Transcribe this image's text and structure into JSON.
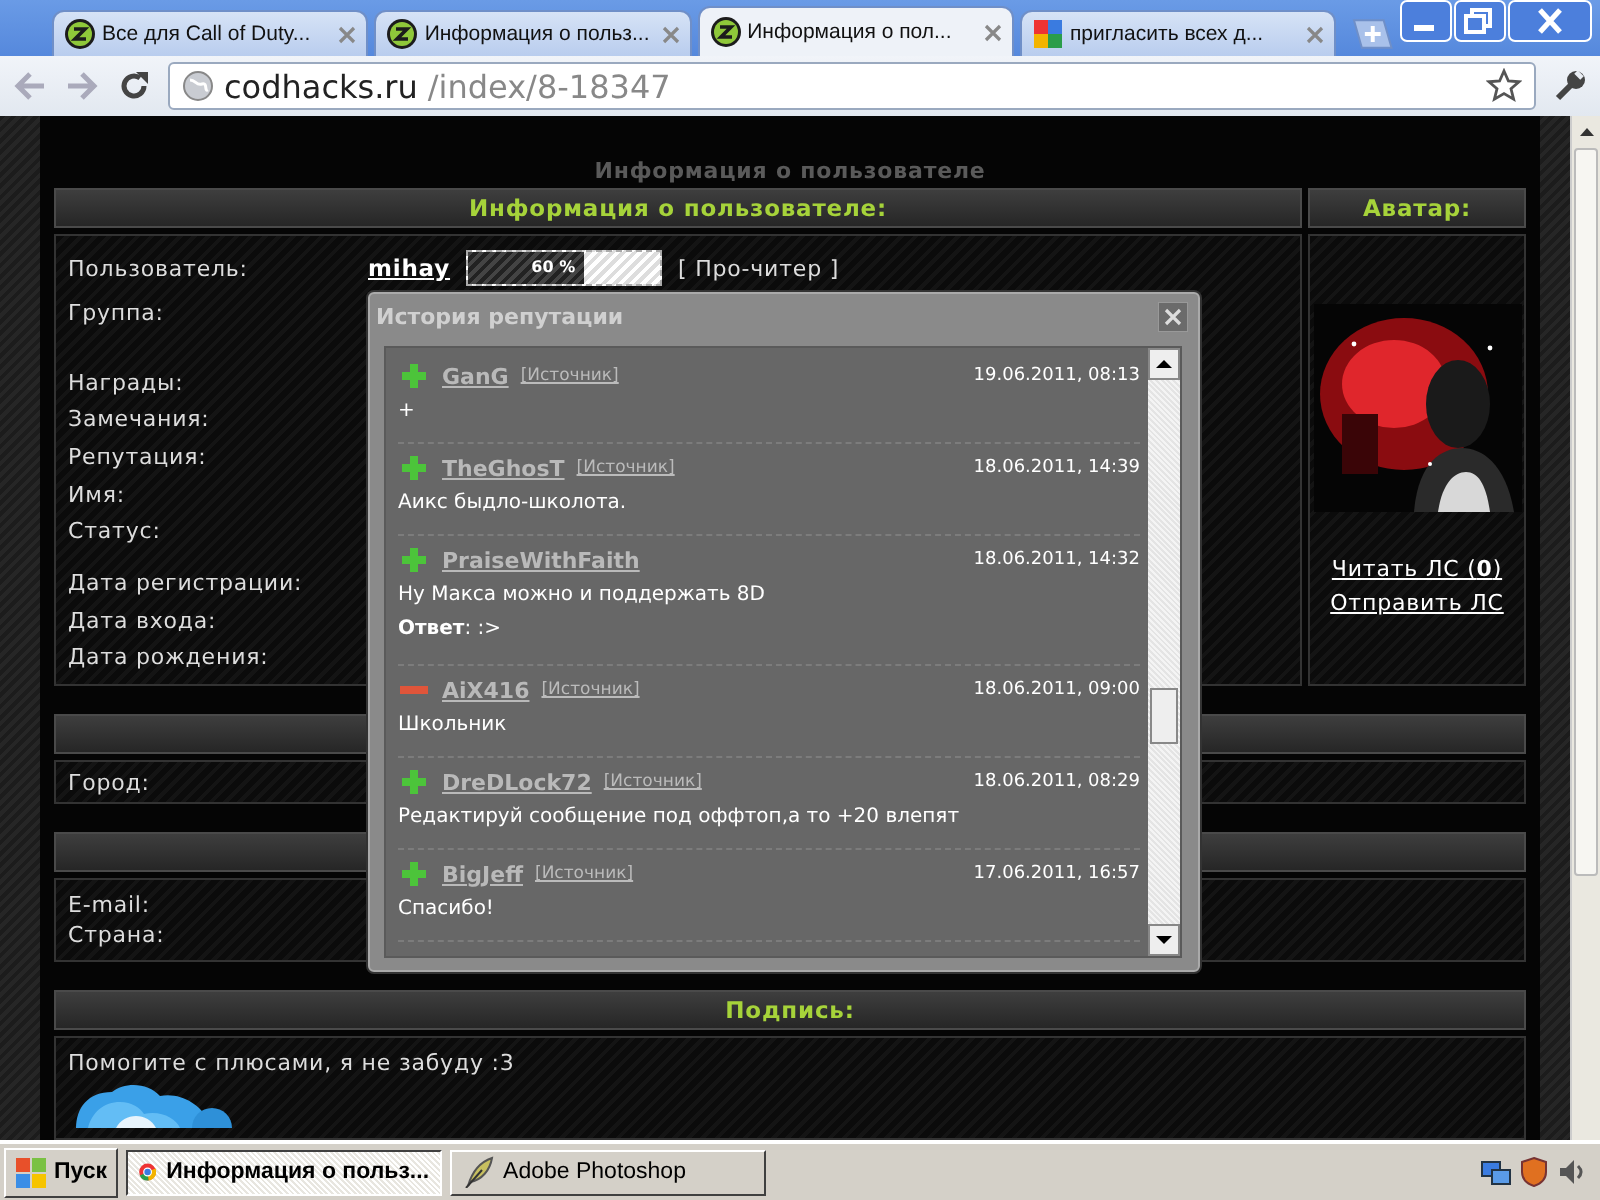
{
  "browser": {
    "tabs": [
      {
        "title": "Все для Call of Duty...",
        "selected": false,
        "kind": "site"
      },
      {
        "title": "Информация о польз...",
        "selected": false,
        "kind": "site"
      },
      {
        "title": "Информация о пол...",
        "selected": true,
        "kind": "site"
      },
      {
        "title": "пригласить всех д...",
        "selected": false,
        "kind": "google"
      }
    ],
    "address": {
      "domain": "codhacks.ru",
      "path": "/index/8-18347"
    }
  },
  "page": {
    "faint_title": "Информация о пользователе",
    "profile": {
      "title": "Информация о пользователе:",
      "fields": [
        {
          "label": "Пользователь:"
        },
        {
          "label": "Группа:"
        },
        {
          "label": "Награды:"
        },
        {
          "label": "Замечания:"
        },
        {
          "label": "Репутация:"
        },
        {
          "label": "Имя:"
        },
        {
          "label": "Статус:"
        },
        {
          "label": "Дата регистрации:"
        },
        {
          "label": "Дата входа:"
        },
        {
          "label": "Дата рождения:"
        }
      ],
      "user": {
        "name": "mihay",
        "level": 0.6,
        "reading": "60 %",
        "rank": "[ Про-читер ]"
      }
    },
    "avatar": {
      "title": "Аватар:",
      "links": [
        "Читать ЛС (**0**)",
        "Отправить ЛС"
      ]
    },
    "location": {
      "fields": [
        "Город:"
      ]
    },
    "contacts": {
      "fields": [
        "E-mail:",
        "Страна:"
      ]
    },
    "signature": {
      "title": "Подпись:",
      "text": "Помогите с плюсами, я не забуду :3"
    }
  },
  "popup": {
    "title": "История репутации",
    "entries": [
      {
        "kind": "plus",
        "user": "GanG",
        "source": "[Источник]",
        "date": "19.06.2011, 08:13",
        "message": "+"
      },
      {
        "kind": "plus",
        "user": "TheGhosT",
        "source": "[Источник]",
        "date": "18.06.2011, 14:39",
        "message": "Аикс быдло-школота."
      },
      {
        "kind": "plus",
        "user": "PraiseWithFaith",
        "date": "18.06.2011, 14:32",
        "message": "Ну Макса можно и поддержать 8D",
        "reply": "**Ответ**: :>"
      },
      {
        "kind": "minus",
        "user": "AiX416",
        "source": "[Источник]",
        "date": "18.06.2011, 09:00",
        "message": "Школьник"
      },
      {
        "kind": "plus",
        "user": "DreDLock72",
        "source": "[Источник]",
        "date": "18.06.2011, 08:29",
        "message": "Редактируй сообщение под оффтоп,а то +20 влепят"
      },
      {
        "kind": "plus",
        "user": "BigJeff",
        "source": "[Источник]",
        "date": "17.06.2011, 16:57",
        "message": "Спасибо!"
      }
    ]
  },
  "taskbar": {
    "start": "Пуск",
    "tasks": [
      {
        "title": "Информация о польз...",
        "selected": true,
        "kind": "browser"
      },
      {
        "title": "Adobe Photoshop",
        "selected": false,
        "kind": "photoshop"
      }
    ]
  }
}
